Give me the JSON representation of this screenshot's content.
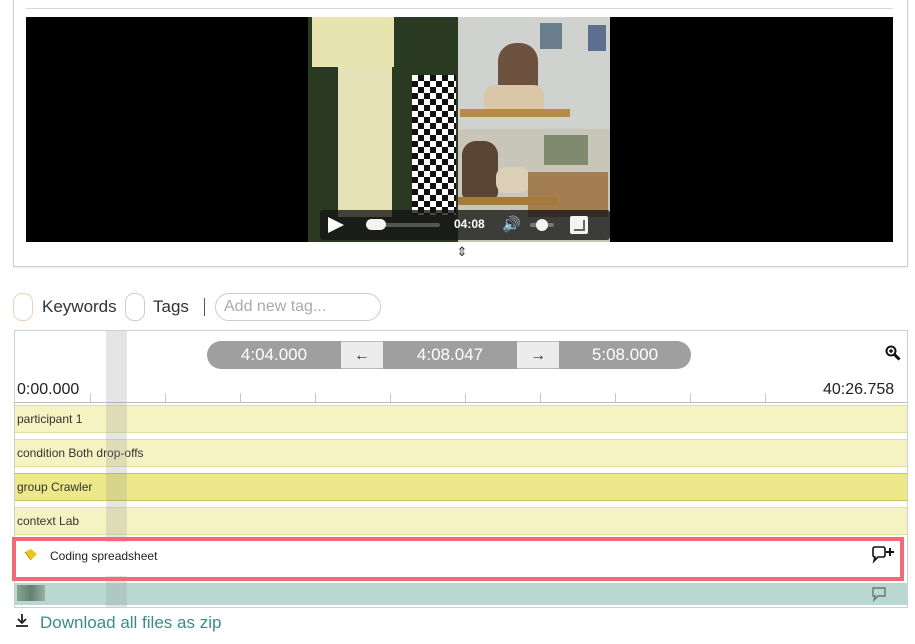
{
  "video": {
    "time_display": "04:08"
  },
  "tag_bar": {
    "keywords_label": "Keywords",
    "tags_label": "Tags",
    "separator": "|",
    "new_tag_placeholder": "Add new tag..."
  },
  "timeline": {
    "nav": {
      "prev_time": "4:04.000",
      "prev_arrow": "←",
      "current_time": "4:08.047",
      "next_arrow": "→",
      "next_time": "5:08.000"
    },
    "ruler_start": "0:00.000",
    "ruler_end": "40:26.758",
    "tracks": [
      {
        "label": "participant 1"
      },
      {
        "label": "condition Both drop-offs"
      },
      {
        "label": "group Crawler"
      },
      {
        "label": "context Lab"
      }
    ],
    "coding_row": {
      "label": "Coding spreadsheet"
    }
  },
  "download": {
    "label": "Download all files as zip"
  },
  "colors": {
    "track": "#f6f3c2",
    "track_active": "#ede889",
    "highlight": "#f06c74",
    "link": "#3a8d86",
    "nav_pill": "#9f9f9f"
  }
}
